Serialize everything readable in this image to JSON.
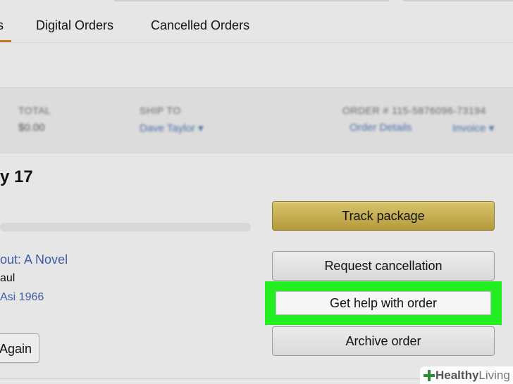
{
  "tabs": [
    {
      "label": "s"
    },
    {
      "label": "Digital Orders"
    },
    {
      "label": "Cancelled Orders"
    }
  ],
  "order_header": {
    "total_label": "TOTAL",
    "total_value": "$0.00",
    "ship_to_label": "SHIP TO",
    "ship_to_value": "Dave Taylor ▾",
    "order_number": "ORDER # 115-5876096-73194",
    "order_details_link": "Order Details",
    "invoice_link": "Invoice ▾"
  },
  "delivery": {
    "arriving_text": "y 17"
  },
  "item": {
    "title": "out: A Novel",
    "author": "aul",
    "seller": "Asi 1966",
    "buy_again_label": "Again"
  },
  "actions": {
    "track_package": "Track package",
    "request_cancellation": "Request cancellation",
    "get_help": "Get help with order",
    "archive_order": "Archive order"
  },
  "watermark": {
    "brand_bold": "Healthy",
    "brand_light": "Living"
  },
  "colors": {
    "highlight": "#22ee22",
    "primary_button": "#c9b354",
    "link": "#3e5aa8",
    "tab_active": "#c07a1c"
  }
}
